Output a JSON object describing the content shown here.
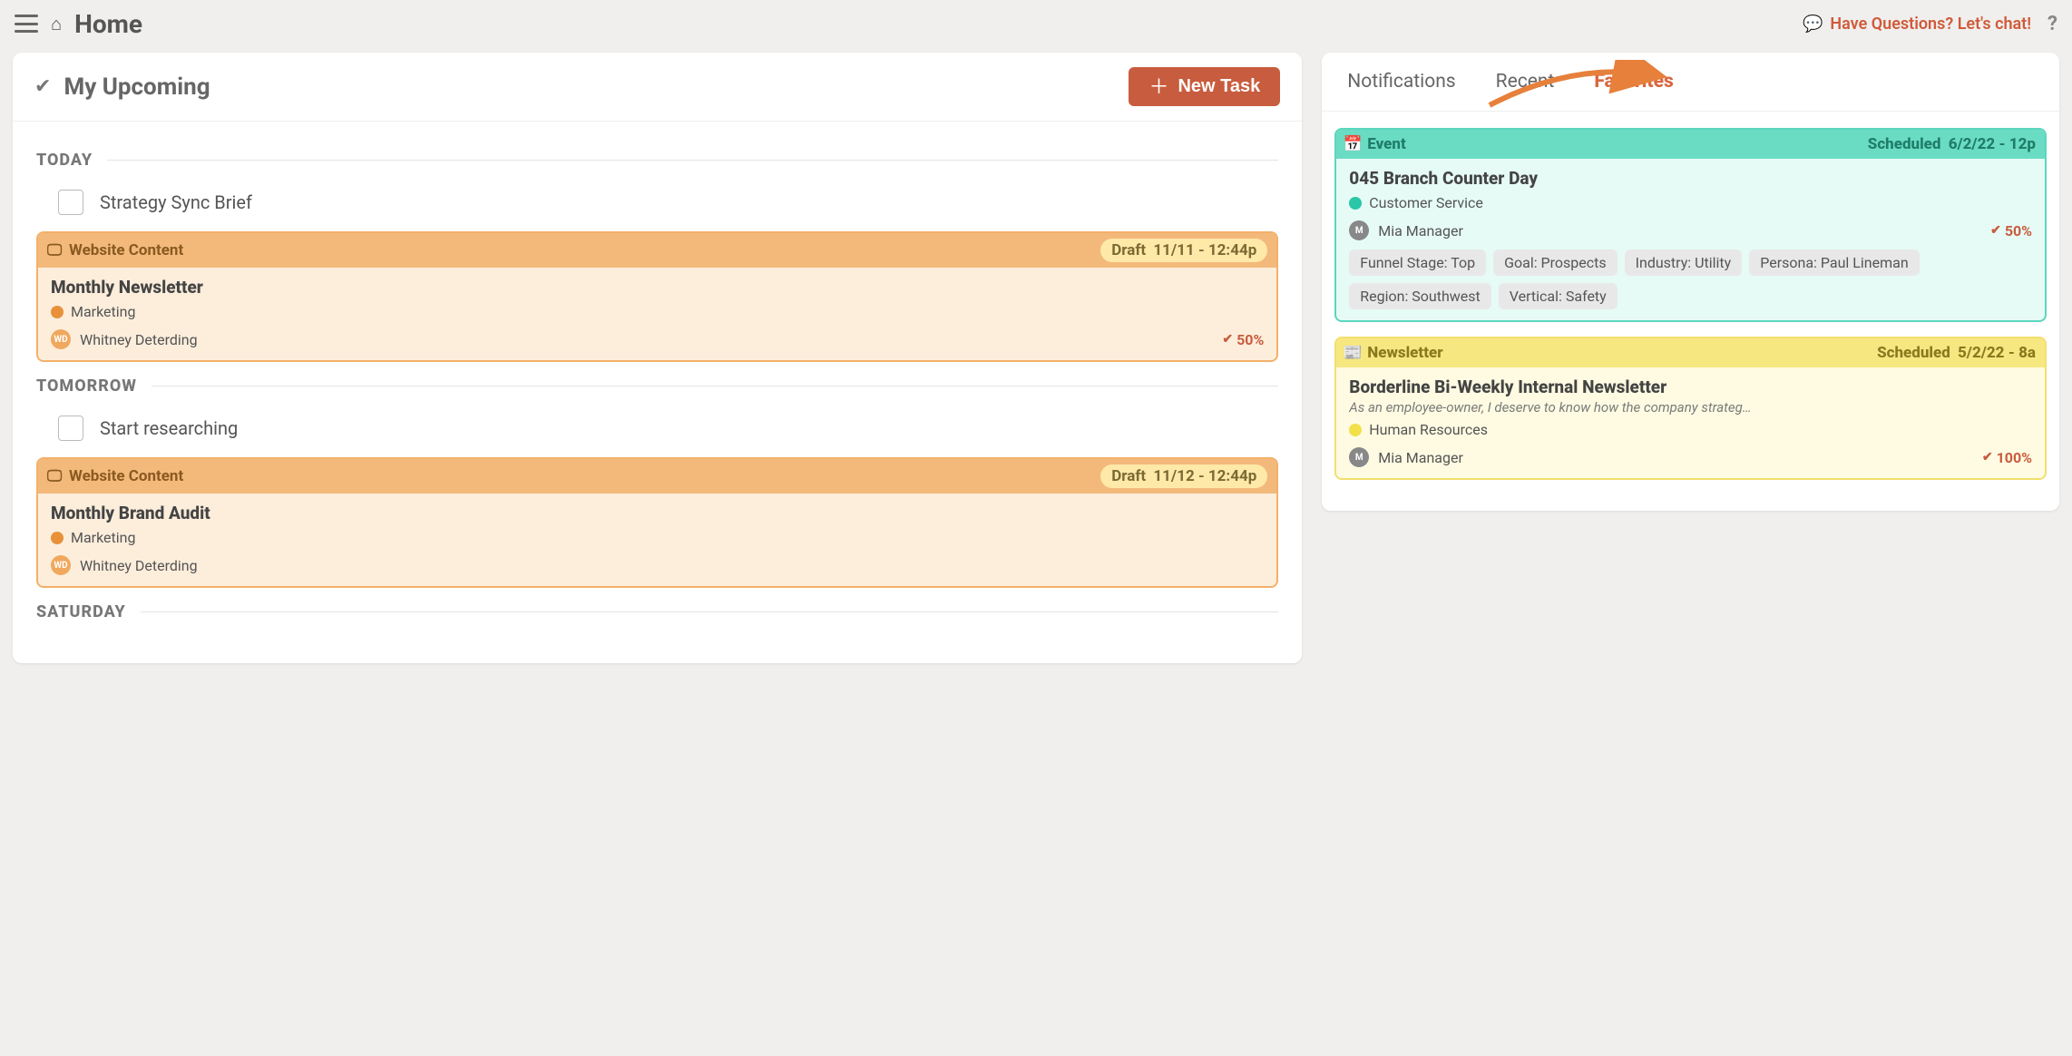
{
  "header": {
    "title": "Home",
    "chat_text": "Have Questions? Let's chat!",
    "help_symbol": "?"
  },
  "upcoming": {
    "title": "My Upcoming",
    "new_task_label": "New Task",
    "sections": [
      {
        "label": "TODAY",
        "plain_task": "Strategy Sync Brief",
        "card": {
          "type_label": "Website Content",
          "status": "Draft",
          "datetime": "11/11 - 12:44p",
          "title": "Monthly Newsletter",
          "category": "Marketing",
          "category_color": "#e8913a",
          "owner": "Whitney Deterding",
          "owner_initials": "WD",
          "progress": "50%"
        }
      },
      {
        "label": "TOMORROW",
        "plain_task": "Start researching",
        "card": {
          "type_label": "Website Content",
          "status": "Draft",
          "datetime": "11/12 - 12:44p",
          "title": "Monthly Brand Audit",
          "category": "Marketing",
          "category_color": "#e8913a",
          "owner": "Whitney Deterding",
          "owner_initials": "WD",
          "progress": ""
        }
      },
      {
        "label": "SATURDAY",
        "plain_task": "",
        "card": null
      }
    ]
  },
  "right": {
    "tabs": [
      "Notifications",
      "Recent",
      "Favorites"
    ],
    "active_tab": "Favorites",
    "favorites": [
      {
        "color": "teal",
        "type_label": "Event",
        "scheduled_label": "Scheduled",
        "scheduled_value": "6/2/22 - 12p",
        "title": "045 Branch Counter Day",
        "subtitle": "",
        "category": "Customer Service",
        "category_color": "#29c7a7",
        "owner": "Mia Manager",
        "progress": "50%",
        "tags": [
          "Funnel Stage: Top",
          "Goal: Prospects",
          "Industry: Utility",
          "Persona: Paul Lineman",
          "Region: Southwest",
          "Vertical: Safety"
        ]
      },
      {
        "color": "yellow",
        "type_label": "Newsletter",
        "scheduled_label": "Scheduled",
        "scheduled_value": "5/2/22 - 8a",
        "title": "Borderline Bi-Weekly Internal Newsletter",
        "subtitle": "As an employee-owner, I deserve to know how the company strateg…",
        "category": "Human Resources",
        "category_color": "#f2e04a",
        "owner": "Mia Manager",
        "progress": "100%",
        "tags": []
      }
    ]
  }
}
